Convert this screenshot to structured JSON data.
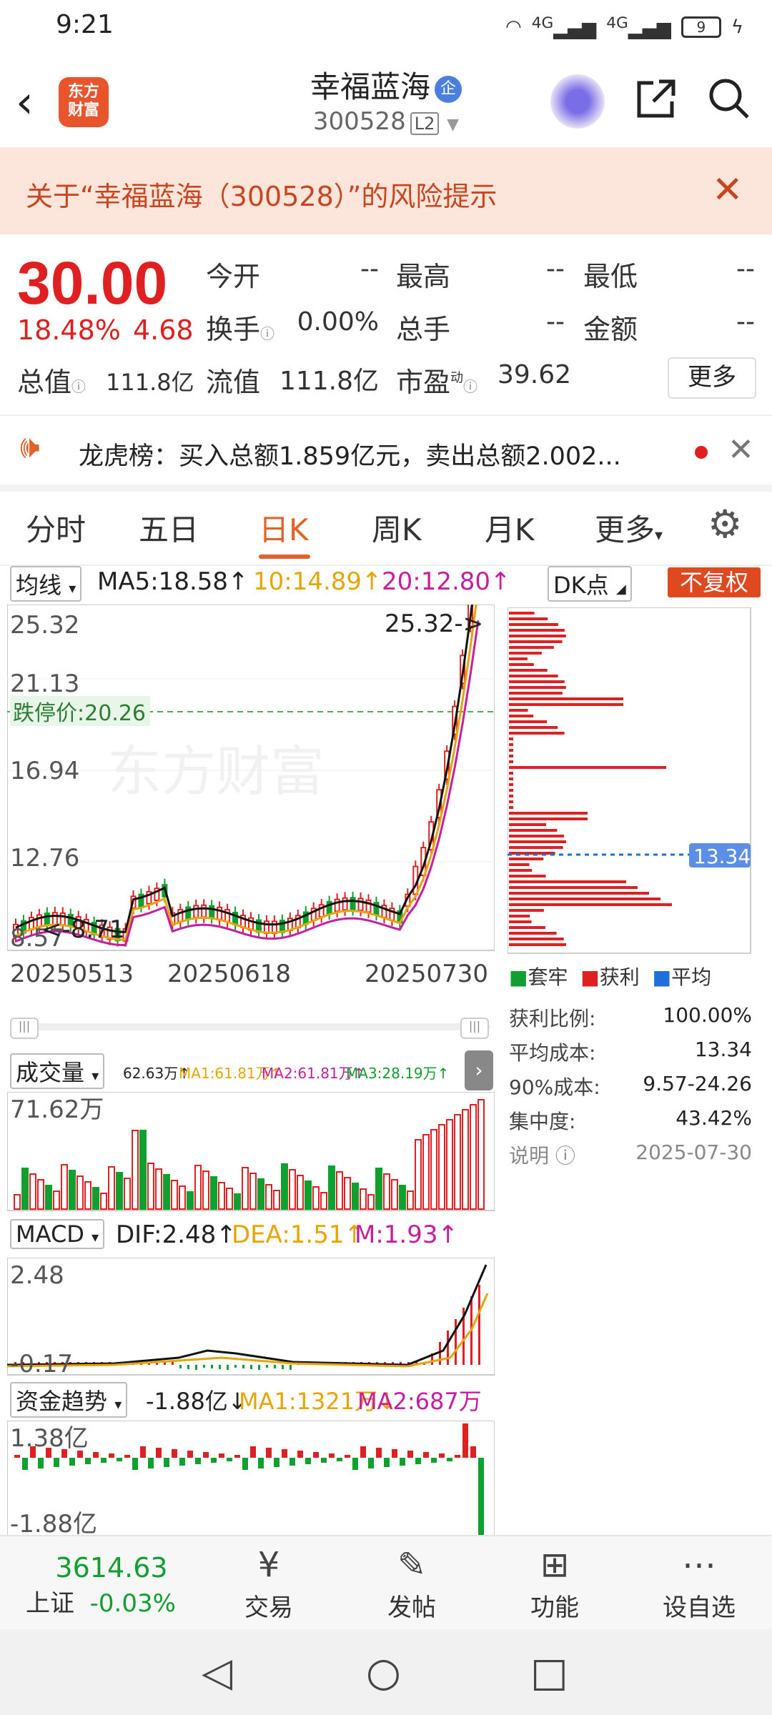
{
  "status_bar": {
    "time": "9:21",
    "signal1": "4G",
    "signal2": "4G",
    "battery": "9"
  },
  "header": {
    "logo_line1": "东方",
    "logo_line2": "财富",
    "stock_name": "幸福蓝海",
    "corp_badge": "企",
    "stock_code": "300528",
    "level": "L2"
  },
  "risk_banner": {
    "text": "关于“幸福蓝海（300528）”的风险提示"
  },
  "quote": {
    "price": "30.00",
    "change_pct": "18.48%",
    "change": "4.68",
    "open_label": "今开",
    "open": "--",
    "high_label": "最高",
    "high": "--",
    "low_label": "最低",
    "low": "--",
    "turnover_label": "换手",
    "turnover": "0.00%",
    "volume_label": "总手",
    "volume": "--",
    "amount_label": "金额",
    "amount": "--",
    "mktcap_label": "总值",
    "mktcap": "111.8亿",
    "float_label": "流值",
    "float": "111.8亿",
    "pe_label": "市盈",
    "pe_sup": "动",
    "pe": "39.62",
    "more": "更多"
  },
  "dragon_tiger": {
    "text": "龙虎榜：买入总额1.859亿元，卖出总额2.002..."
  },
  "tabs": [
    "分时",
    "五日",
    "日K",
    "周K",
    "月K",
    "更多"
  ],
  "active_tab": "日K",
  "ma_row": {
    "selector": "均线",
    "ma5": "MA5:18.58↑",
    "ma10": "10:14.89↑",
    "ma20": "20:12.80↑",
    "dk": "DK点",
    "fq": "不复权"
  },
  "kline": {
    "y_ticks": [
      "25.32",
      "21.13",
      "16.94",
      "12.76",
      "8.57"
    ],
    "max_label": "25.32->",
    "min_label": "<-8.71",
    "limit_down_label": "跌停价:20.26",
    "watermark": "东方财富",
    "x_ticks": [
      "20250513",
      "20250618",
      "20250730"
    ]
  },
  "chip": {
    "avg_label": "13.34",
    "legend": [
      "套牢",
      "获利",
      "平均"
    ],
    "stats": [
      {
        "k": "获利比例:",
        "v": "100.00%"
      },
      {
        "k": "平均成本:",
        "v": "13.34"
      },
      {
        "k": "90%成本:",
        "v": "9.57-24.26"
      },
      {
        "k": "集中度:",
        "v": "43.42%"
      }
    ],
    "note": "说明",
    "date": "2025-07-30"
  },
  "volume": {
    "selector": "成交量",
    "vol": "62.63万↑",
    "ma1": "MA1:61.81万↑",
    "ma2": "MA2:61.81万↑",
    "ma3": "MA3:28.19万↑",
    "top_label": "71.62万"
  },
  "macd": {
    "selector": "MACD",
    "dif": "DIF:2.48↑",
    "dea": "DEA:1.51↑",
    "m": "M:1.93↑",
    "top_label": "2.48",
    "bottom_label": "-0.17"
  },
  "fund": {
    "selector": "资金趋势",
    "val": "-1.88亿↓",
    "ma1": "MA1:1321万↓",
    "ma2": "MA2:687万↓",
    "top_label": "1.38亿",
    "bottom_label": "-1.88亿"
  },
  "bottom_nav": {
    "index_value": "3614.63",
    "index_name": "上证",
    "index_change": "-0.03%",
    "items": [
      "交易",
      "发帖",
      "功能",
      "设自选"
    ]
  },
  "colors": {
    "up": "#e02020",
    "down": "#10a030",
    "accent": "#e0632c"
  }
}
